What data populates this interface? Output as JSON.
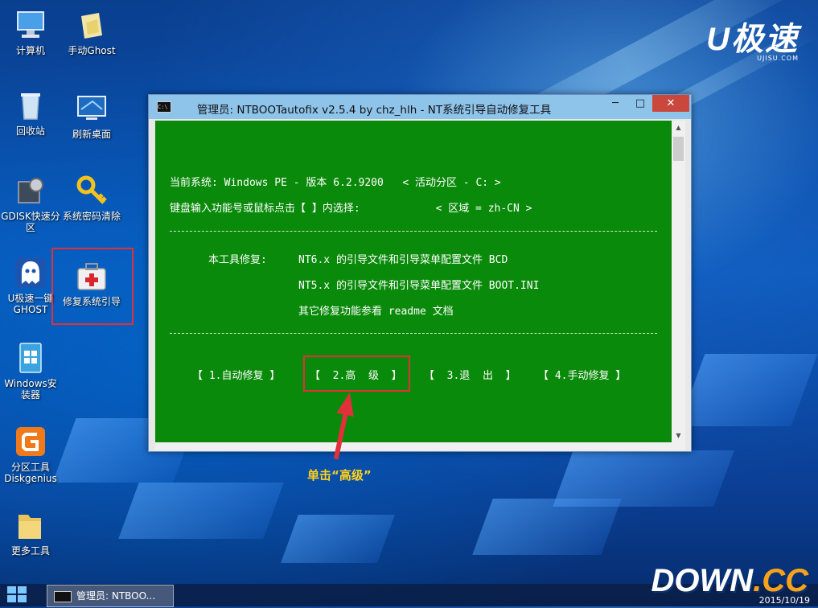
{
  "desktop": {
    "icons": [
      {
        "label": "计算机",
        "icon": "computer-icon"
      },
      {
        "label": "手动Ghost",
        "icon": "ghost-tool-icon"
      },
      {
        "label": "回收站",
        "icon": "recycle-bin-icon"
      },
      {
        "label": "刷新桌面",
        "icon": "refresh-desktop-icon"
      },
      {
        "label": "GDISK快速分区",
        "icon": "gdisk-icon"
      },
      {
        "label": "系统密码清除",
        "icon": "key-icon"
      },
      {
        "label": "U极速一键GHOST",
        "icon": "ghost-icon"
      },
      {
        "label": "修复系统引导",
        "icon": "repair-kit-icon"
      },
      {
        "label": "Windows安装器",
        "icon": "windows-installer-icon"
      },
      {
        "label": "分区工具Diskgenius",
        "icon": "diskgenius-icon"
      },
      {
        "label": "更多工具",
        "icon": "folder-icon"
      }
    ],
    "logo": {
      "main": "U极速",
      "sub": "UJISU.COM"
    }
  },
  "window": {
    "title": "管理员:  NTBOOTautofix v2.5.4 by chz_hlh - NT系统引导自动修复工具",
    "controls": {
      "minimize": "─",
      "maximize": "□",
      "close": "✕"
    },
    "console": {
      "line1": "当前系统: Windows PE - 版本 6.2.9200   < 活动分区 - C: >",
      "line2": "键盘输入功能号或鼠标点击【 】内选择:            < 区域 = zh-CN >",
      "repair_label": "本工具修复:",
      "repair1": "NT6.x 的引导文件和引导菜单配置文件 BCD",
      "repair2": "NT5.x 的引导文件和引导菜单配置文件 BOOT.INI",
      "repair3": "其它修复功能参看 readme 文档",
      "menu": {
        "auto": "【 1.自动修复 】",
        "advanced": "【  2.高  级  】",
        "exit": "【  3.退  出  】",
        "manual": "【 4.手动修复 】"
      }
    }
  },
  "annotation": "单击“高级”",
  "taskbar": {
    "task_label": "管理员: NTBOO...",
    "clock": "2015/10/19"
  },
  "watermark": {
    "main": "DOWN",
    "accent": ".CC"
  }
}
